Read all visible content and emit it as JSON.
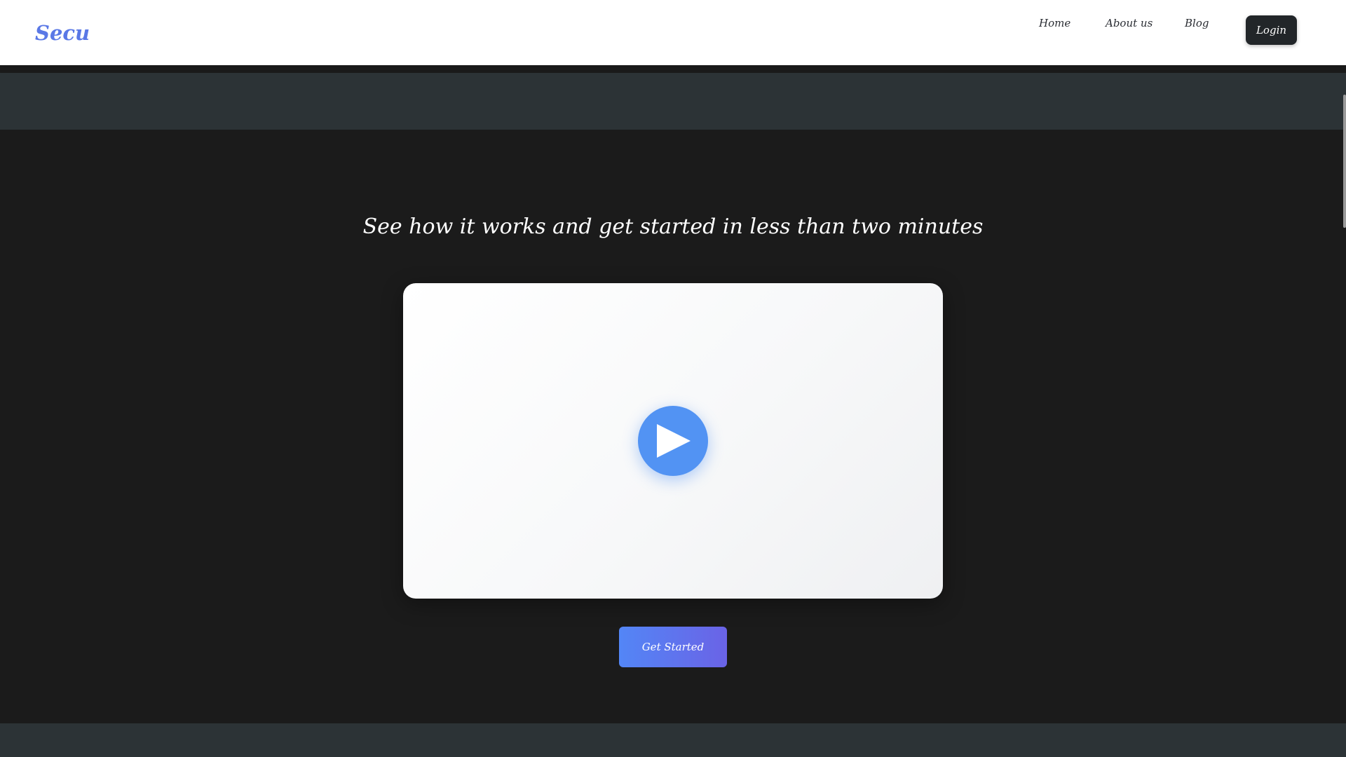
{
  "brand": {
    "name": "Secu",
    "color": "#5a78e6"
  },
  "nav": {
    "links": [
      "Home",
      "About us",
      "Blog"
    ],
    "login_label": "Login"
  },
  "hero": {
    "headline": "See how it works and get started in less than two minutes",
    "video": {
      "play_icon": "play-icon",
      "accent": "#5293f3"
    },
    "cta_label": "Get Started"
  },
  "colors": {
    "background": "#1b1b1b",
    "band": "#2c3336",
    "cta_gradient_start": "#5386f6",
    "cta_gradient_end": "#6a63e6"
  }
}
